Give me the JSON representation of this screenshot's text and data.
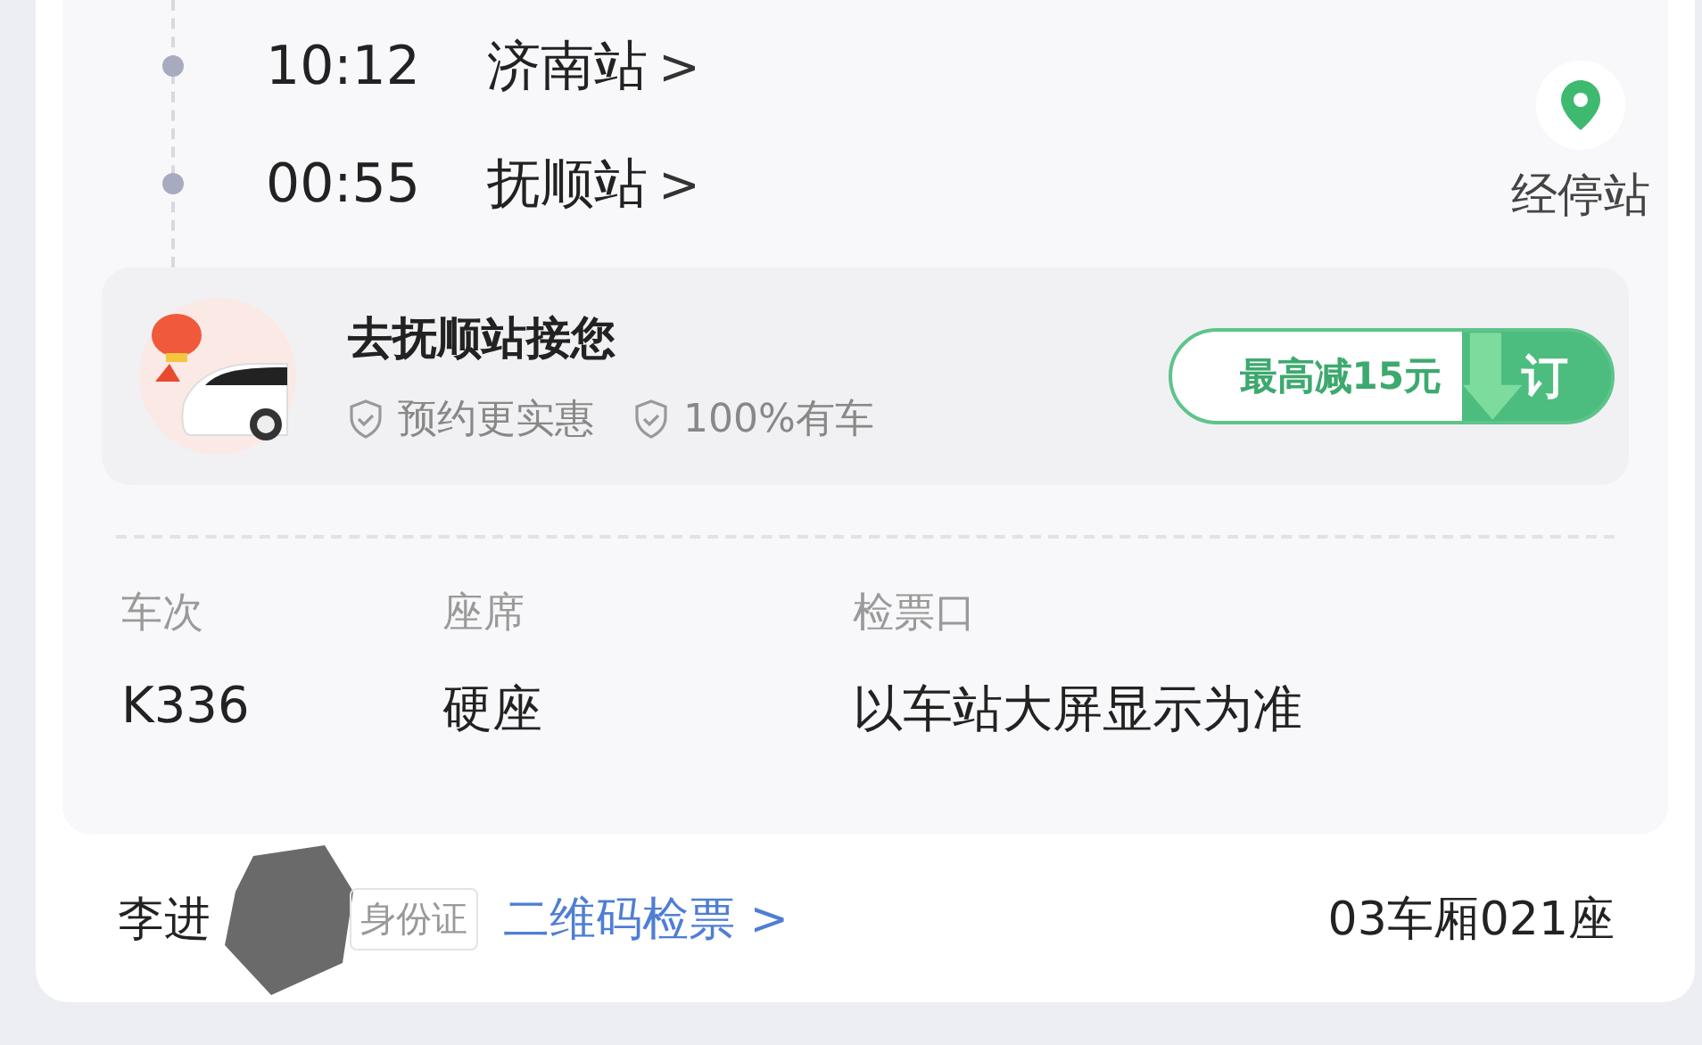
{
  "stops": [
    {
      "time": "10:12",
      "station": "济南站",
      "chevron": ">"
    },
    {
      "time": "00:55",
      "station": "抚顺站",
      "chevron": ">"
    }
  ],
  "stops_button": {
    "label": "经停站"
  },
  "promo": {
    "title": "去抚顺站接您",
    "features": [
      "预约更实惠",
      "100%有车"
    ],
    "offer": "最高减15元",
    "action": "订"
  },
  "info": [
    {
      "label": "车次",
      "value": "K336"
    },
    {
      "label": "座席",
      "value": "硬座"
    },
    {
      "label": "检票口",
      "value": "以车站大屏显示为准"
    }
  ],
  "passenger": {
    "name": "李进",
    "id_type": "身份证",
    "link": "二维码检票",
    "link_chevron": ">",
    "seat": "03车厢021座"
  }
}
